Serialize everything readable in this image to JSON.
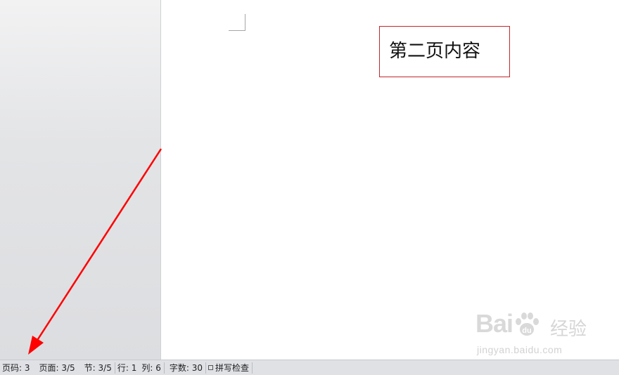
{
  "document": {
    "text_box": "第二页内容"
  },
  "watermark": {
    "brand": "Bai",
    "brand_cn": "经验",
    "url": "jingyan.baidu.com"
  },
  "status_bar": {
    "page_number": "页码: 3",
    "page": "页面: 3/5",
    "section": "节: 3/5",
    "line": "行: 1",
    "column": "列: 6",
    "word_count": "字数: 30",
    "spell_check": "拼写检查"
  },
  "colors": {
    "arrow": "#ff0000",
    "text_box_border": "#c0272d",
    "status_bar_bg": "#dfe1e5"
  },
  "icons": {
    "spell_check": "checkbox-icon",
    "annotation": "red-arrow"
  }
}
